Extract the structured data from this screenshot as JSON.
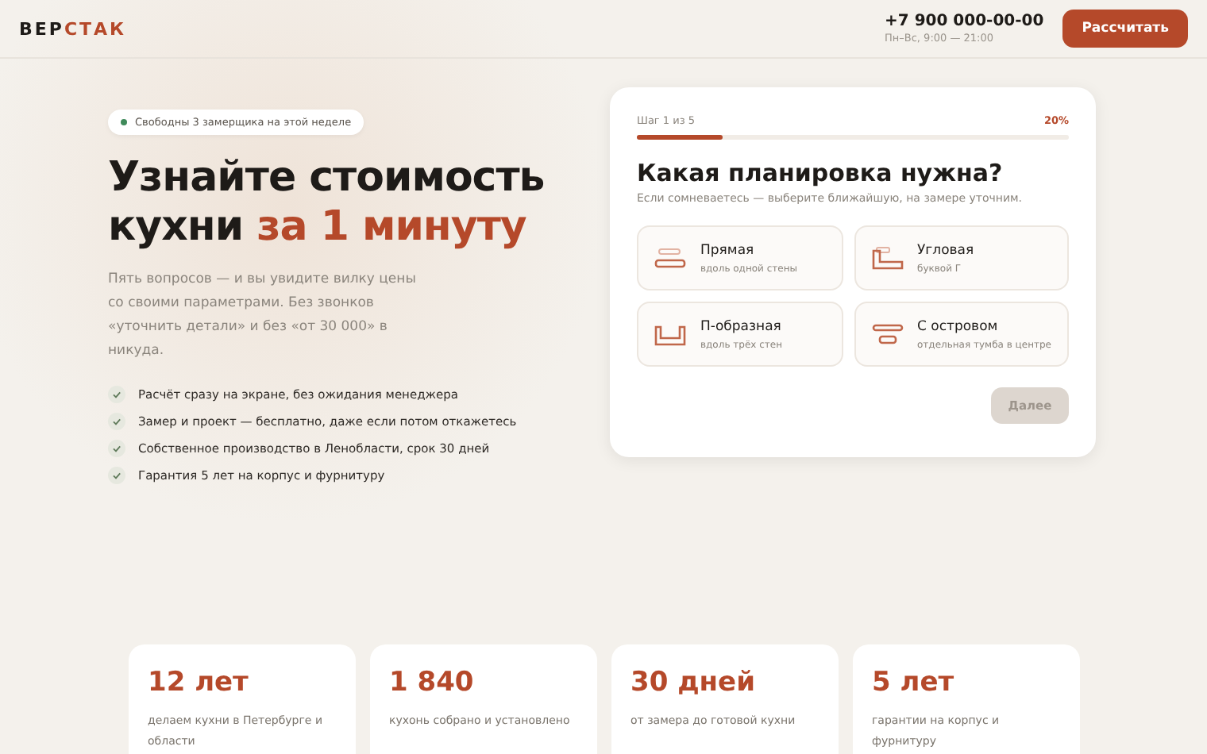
{
  "header": {
    "logo": {
      "dark": "ВЕР",
      "accent": "СТАК"
    },
    "phone": "+7 900 000-00-00",
    "hours": "Пн–Вс, 9:00 — 21:00",
    "cta": "Рассчитать"
  },
  "hero": {
    "badge": "Свободны 3 замерщика на этой неделе",
    "title": "Узнайте стоимость кухни",
    "title_accent": "за 1 минуту",
    "lead": "Пять вопросов — и вы увидите вилку цены со своими параметрами. Без звонков «уточнить детали» и без «от 30 000» в никуда.",
    "benefits": [
      "Расчёт сразу на экране, без ожидания менеджера",
      "Замер и проект — бесплатно, даже если потом откажетесь",
      "Собственное производство в Ленобласти, срок 30 дней",
      "Гарантия 5 лет на корпус и фурнитуру"
    ]
  },
  "quiz": {
    "step": "Шаг 1 из 5",
    "percent": "20%",
    "level": 0.2,
    "question": "Какая планировка нужна?",
    "hint": "Если сомневаетесь — выберите ближайшую, на замере уточним.",
    "options": [
      {
        "kind": "straight",
        "title": "Прямая",
        "subtitle": "вдоль одной стены"
      },
      {
        "kind": "corner",
        "title": "Угловая",
        "subtitle": "буквой Г"
      },
      {
        "kind": "u",
        "title": "П-образная",
        "subtitle": "вдоль трёх стен"
      },
      {
        "kind": "island",
        "title": "С островом",
        "subtitle": "отдельная тумба в центре"
      }
    ],
    "next": {
      "label": "Далее",
      "disabled": true
    }
  },
  "stats": [
    {
      "value": "12 лет",
      "caption": "делаем кухни в Петербурге и области"
    },
    {
      "value": "1 840",
      "caption": "кухонь собрано и установлено"
    },
    {
      "value": "30 дней",
      "caption": "от замера до готовой кухни"
    },
    {
      "value": "5 лет",
      "caption": "гарантии на корпус и фурнитуру"
    }
  ]
}
